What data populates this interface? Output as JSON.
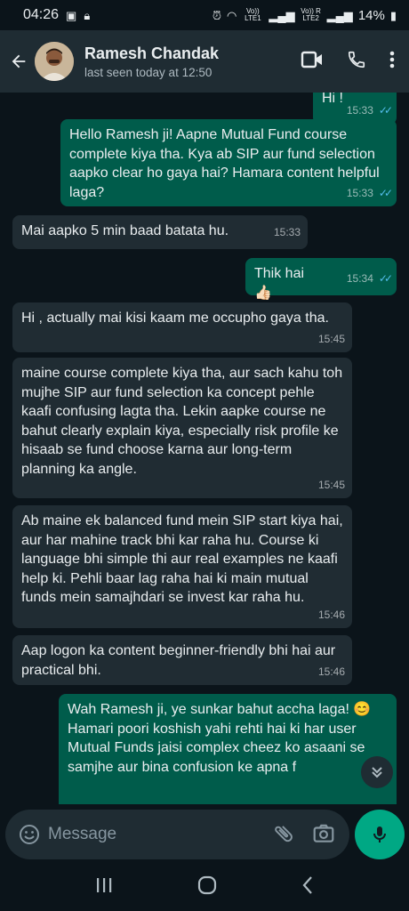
{
  "status_bar": {
    "time": "04:26",
    "net1": "Vo)) LTE1",
    "net2": "Vo)) R LTE2",
    "battery": "14%"
  },
  "header": {
    "contact_name": "Ramesh Chandak",
    "last_seen": "last seen today at 12:50"
  },
  "messages": [
    {
      "dir": "out",
      "text": "Hi !",
      "time": "15:33",
      "read": true
    },
    {
      "dir": "out",
      "text": "Hello Ramesh ji! Aapne Mutual Fund course complete kiya tha. Kya ab SIP aur fund selection aapko clear ho gaya hai? Hamara content helpful laga?",
      "time": "15:33",
      "read": true
    },
    {
      "dir": "in",
      "text": "Mai aapko 5 min baad batata hu.",
      "time": "15:33"
    },
    {
      "dir": "out",
      "text": "Thik hai 👍🏻",
      "time": "15:34",
      "read": true
    },
    {
      "dir": "in",
      "text": "Hi , actually mai kisi kaam me occupho gaya tha.",
      "time": "15:45"
    },
    {
      "dir": "in",
      "text": "maine course complete kiya tha, aur sach kahu toh mujhe SIP aur fund selection ka concept pehle kaafi confusing lagta tha. Lekin aapke course ne bahut clearly explain kiya, especially risk profile ke hisaab se fund choose karna aur long-term planning ka angle.",
      "time": "15:45"
    },
    {
      "dir": "in",
      "text": "Ab maine ek balanced fund mein SIP start kiya hai, aur har mahine track bhi kar raha hu. Course ki language bhi simple thi aur real examples ne kaafi help ki. Pehli baar lag raha hai ki main mutual funds mein samajhdari se invest kar raha hu.",
      "time": "15:46"
    },
    {
      "dir": "in",
      "text": "Aap logon ka content beginner-friendly bhi hai aur practical bhi.",
      "time": "15:46"
    },
    {
      "dir": "out",
      "text": "Wah Ramesh ji, ye sunkar bahut accha laga! 😊 Hamari poori koshish yahi rehti hai ki har user Mutual Funds jaisi complex cheez ko asaani se samjhe aur bina confusion ke apna f",
      "time": "",
      "read": false
    }
  ],
  "composer": {
    "placeholder": "Message"
  },
  "icons": {
    "back": "arrow-left-icon",
    "video": "video-call-icon",
    "call": "phone-icon",
    "menu": "more-vertical-icon",
    "emoji": "emoji-icon",
    "attach": "paperclip-icon",
    "camera": "camera-icon",
    "mic": "mic-icon",
    "scroll": "double-chevron-down-icon"
  },
  "colors": {
    "outgoing_bubble": "#005c4b",
    "incoming_bubble": "#202c33",
    "header_bg": "#1f2c33",
    "accent": "#00a884",
    "read_ticks": "#53bdeb"
  }
}
